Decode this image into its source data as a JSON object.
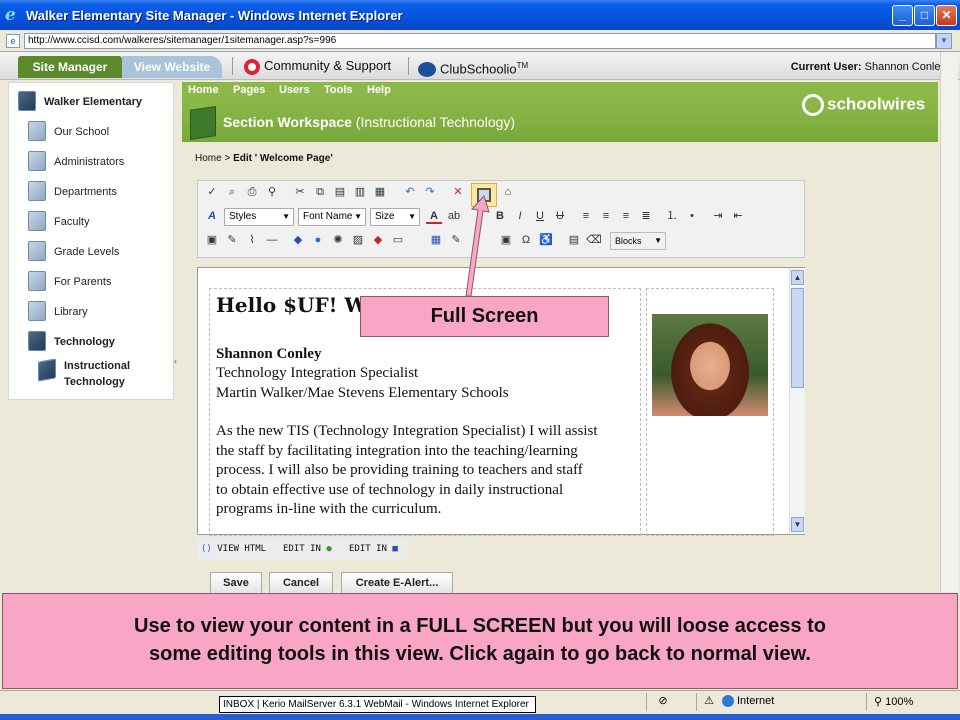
{
  "window": {
    "title": "Walker Elementary Site Manager - Windows Internet Explorer",
    "minimize": "_",
    "maximize": "□",
    "close": "✕"
  },
  "address": {
    "url": "http://www.ccisd.com/walkeres/sitemanager/1sitemanager.asp?s=996"
  },
  "header": {
    "tab_site_manager": "Site Manager",
    "tab_view_website": "View Website",
    "community": "Community & Support",
    "clubschoolio": "ClubSchoolio",
    "clubschoolio_tm": "TM",
    "current_user_label": "Current User:",
    "current_user_name": "Shannon Conley"
  },
  "sidebar": {
    "items": [
      {
        "label": "Walker Elementary"
      },
      {
        "label": "Our School"
      },
      {
        "label": "Administrators"
      },
      {
        "label": "Departments"
      },
      {
        "label": "Faculty"
      },
      {
        "label": "Grade Levels"
      },
      {
        "label": "For Parents"
      },
      {
        "label": "Library"
      },
      {
        "label": "Technology"
      },
      {
        "label": "Instructional Technology"
      }
    ],
    "collapse_glyph": "‹"
  },
  "workspace": {
    "nav": [
      "Home",
      "Pages",
      "Users",
      "Tools",
      "Help"
    ],
    "title": "Section Workspace",
    "title_suffix": "(Instructional Technology)",
    "logo": "schoolwires"
  },
  "breadcrumb": {
    "home": "Home",
    "sep": ">",
    "current": "Edit ' Welcome Page'"
  },
  "toolbar": {
    "styles": "Styles",
    "font_name": "Font Name",
    "size": "Size",
    "blocks": "Blocks"
  },
  "content": {
    "heading": "Hello $UF! We",
    "name": "Shannon Conley",
    "title_line": "Technology Integration Specialist",
    "schools": "Martin Walker/Mae Stevens Elementary Schools",
    "para": [
      "As the new TIS (Technology Integration Specialist) I will assist",
      "the staff by facilitating integration into the teaching/learning",
      "process. I will also be providing training to teachers and staff",
      "to obtain effective use of technology in daily instructional",
      "programs in-line with the curriculum."
    ]
  },
  "editor_tabs": {
    "view_html": "VIEW HTML",
    "edit_in_1": "EDIT IN",
    "edit_in_2": "EDIT IN"
  },
  "buttons": {
    "save": "Save",
    "cancel": "Cancel",
    "create_alert": "Create E-Alert..."
  },
  "callout": {
    "label": "Full Screen",
    "info_line1": "Use to view your content in a FULL SCREEN but you will loose access to",
    "info_line2": "some editing tools in this view. Click again to go back to normal view."
  },
  "status": {
    "taskbar": "INBOX | Kerio MailServer 6.3.1 WebMail - Windows Internet Explorer",
    "zone": "Internet",
    "zoom": "100%"
  },
  "colors": {
    "accent_green": "#8cb84a",
    "callout_pink": "#f9a6c6",
    "xp_blue": "#0453dc"
  }
}
